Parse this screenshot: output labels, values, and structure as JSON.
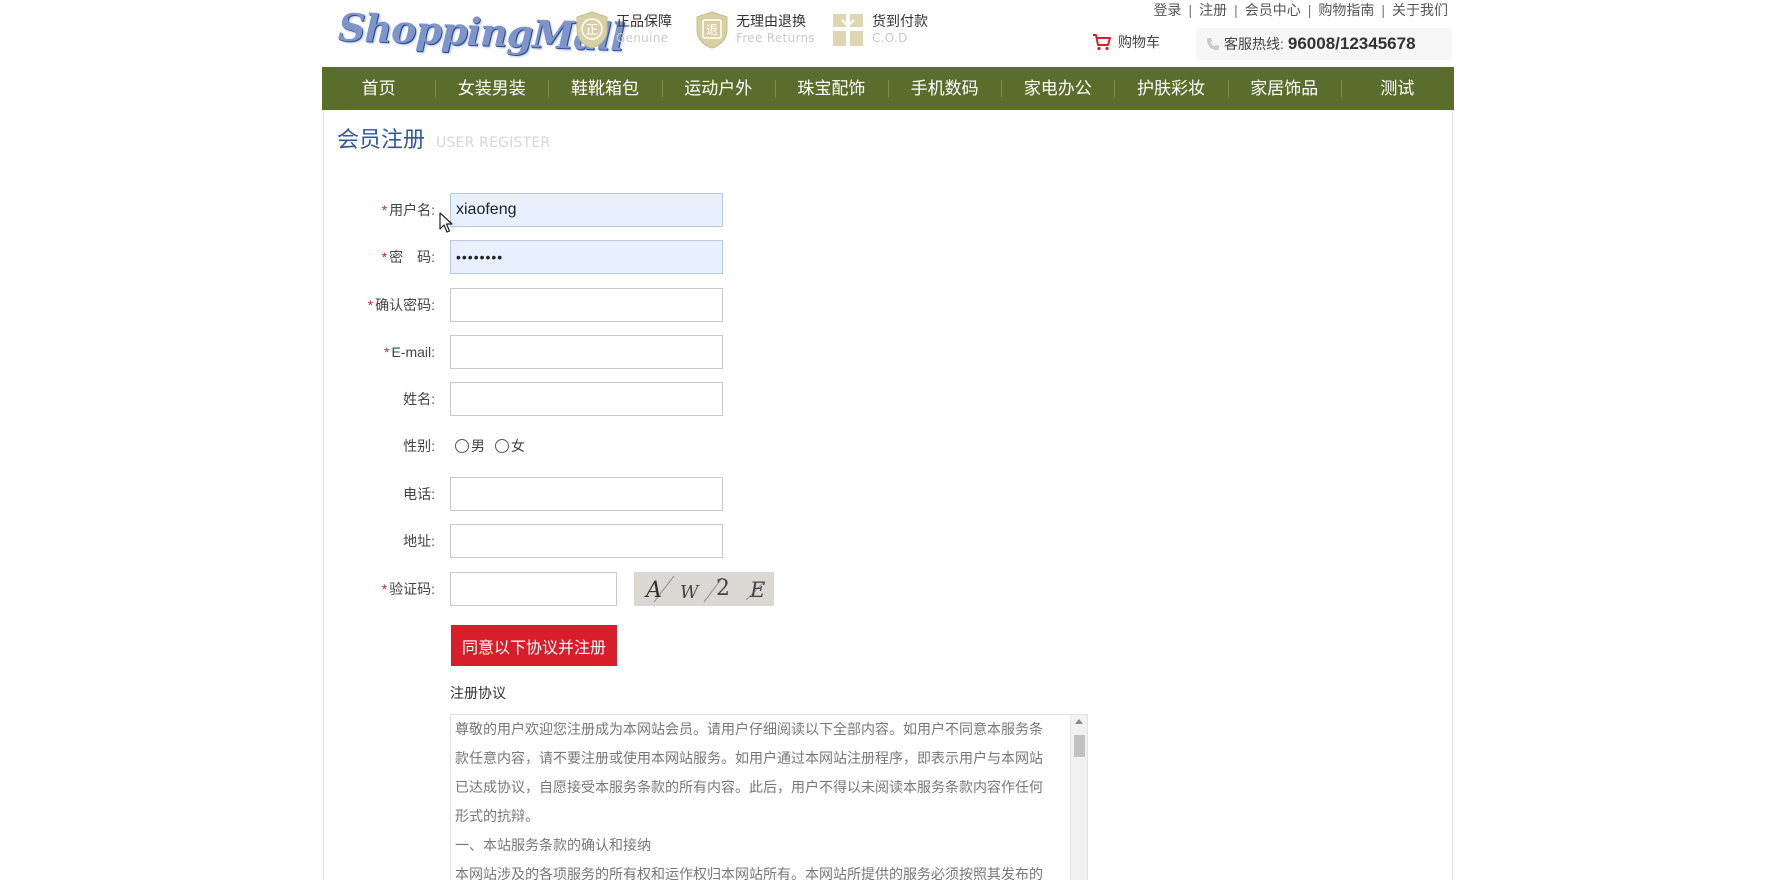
{
  "header": {
    "logo_text": "ShoppingMall",
    "promos": [
      {
        "icon": "genuine-shield-icon",
        "glyph": "正",
        "title": "正品保障",
        "subtitle": "Genuine"
      },
      {
        "icon": "return-shield-icon",
        "glyph": "退",
        "title": "无理由退换",
        "subtitle": "Free Returns"
      },
      {
        "icon": "cod-gift-icon",
        "glyph": "",
        "title": "货到付款",
        "subtitle": "C.O.D"
      }
    ],
    "top_links": [
      "登录",
      "注册",
      "会员中心",
      "购物指南",
      "关于我们"
    ],
    "cart_label": "购物车",
    "hotline_label": "客服热线:",
    "hotline_number": "96008/12345678"
  },
  "nav": {
    "items": [
      "首页",
      "女装男装",
      "鞋靴箱包",
      "运动户外",
      "珠宝配饰",
      "手机数码",
      "家电办公",
      "护肤彩妆",
      "家居饰品",
      "测试"
    ],
    "background": "#5a6d2c"
  },
  "page": {
    "title_cn": "会员注册",
    "title_en": "USER REGISTER"
  },
  "form": {
    "username": {
      "label": "用户名:",
      "required": "*",
      "value": "xiaofeng"
    },
    "password": {
      "label": "密　码:",
      "required": "*",
      "value": "••••••••"
    },
    "confirm_password": {
      "label": "确认密码:",
      "required": "*",
      "value": ""
    },
    "email": {
      "label": "E-mail:",
      "required": "*",
      "value": ""
    },
    "name": {
      "label": "姓名:",
      "value": ""
    },
    "gender": {
      "label": "性别:",
      "options": [
        "男",
        "女"
      ]
    },
    "phone": {
      "label": "电话:",
      "value": ""
    },
    "address": {
      "label": "地址:",
      "value": ""
    },
    "captcha": {
      "label": "验证码:",
      "required": "*",
      "value": "",
      "image_text": "AW2E"
    },
    "submit_label": "同意以下协议并注册",
    "accent": "#d81e2a"
  },
  "agreement": {
    "title": "注册协议",
    "lines": [
      "尊敬的用户欢迎您注册成为本网站会员。请用户仔细阅读以下全部内容。如用户不同意本服务条",
      "款任意内容，请不要注册或使用本网站服务。如用户通过本网站注册程序，即表示用户与本网站",
      "已达成协议，自愿接受本服务条款的所有内容。此后，用户不得以未阅读本服务条款内容作任何",
      "形式的抗辩。",
      "一、本站服务条款的确认和接纳",
      "本网站涉及的各项服务的所有权和运作权归本网站所有。本网站所提供的服务必须按照其发布的"
    ]
  }
}
